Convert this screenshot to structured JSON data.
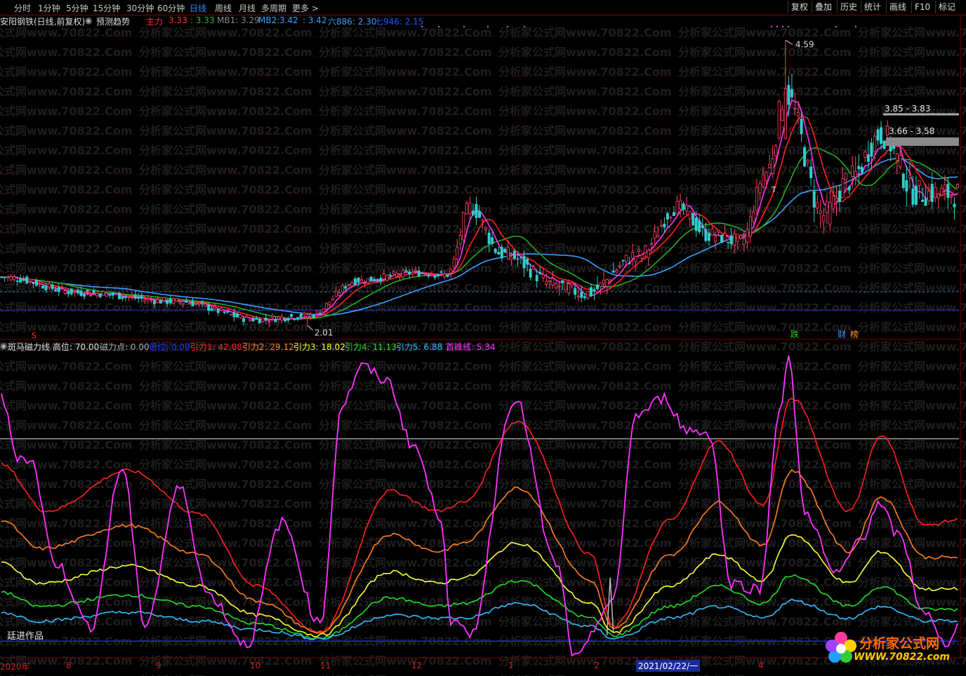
{
  "toolbar": {
    "timeframes": [
      "分时",
      "1分钟",
      "5分钟",
      "15分钟",
      "30分钟",
      "60分钟",
      "日线",
      "周线",
      "月线",
      "多周期",
      "更多 >"
    ],
    "active": "日线",
    "right_buttons": [
      "复权",
      "叠加",
      "历史",
      "统计",
      "画线",
      "F10",
      "标记"
    ]
  },
  "header": {
    "title": "安阳钢铁(日线,前复权)",
    "predict": "预测趋势",
    "zhuli_label": "主力",
    "zhuli_val": "3.33",
    "v2": ": 3.33",
    "mb1": "MB1: 3.29",
    "mb2_label": "MB2:",
    "mb2_val": "3.42",
    "v3": ": 3.42",
    "liu": "六886: 2.30",
    "qi": "七946: 2.15"
  },
  "osc_header": {
    "name": "斑马磁力线",
    "gao": "高位: 70.00",
    "cili": "磁力点: 0.00",
    "diwei": "低位: 0.00",
    "yl1": "引力1: 42.08",
    "yl2": "引力2: 29.12",
    "yl3": "引力3: 18.02",
    "yl4": "引力4: 11.13",
    "yl5": "引力5: 6.88",
    "sf": "首峰线: 5.34"
  },
  "annotations": {
    "high": "4.59",
    "low": "2.01",
    "range1": "3.85 - 3.83",
    "range2": "3.66 - 3.58",
    "tag_die": "跌",
    "tag_cai": "财",
    "tag_bang": "榜",
    "tag_s": "S",
    "tag_t": "T"
  },
  "watermark": "分析家公式网www.70822.Com",
  "credit": "廷进作品",
  "logo": {
    "text": "分析家公式网",
    "url": "WWW.70822.com"
  },
  "time_axis": {
    "labels": [
      "2020年",
      "8",
      "9",
      "10",
      "11",
      "12",
      "1",
      "2",
      "4"
    ],
    "current": "2021/02/22/一"
  },
  "colors": {
    "up": "#ff4466",
    "down": "#33cccc",
    "ma_red": "#ff2020",
    "ma_magenta": "#ff33ff",
    "ma_green": "#22aa22",
    "ma_blue": "#3aa0ff",
    "yl1": "#ff2020",
    "yl2": "#ff7f1e",
    "yl3": "#ffff33",
    "yl4": "#22dd22",
    "yl5": "#33bbff",
    "sf": "#ff33ff"
  },
  "chart_data": [
    {
      "type": "candlestick",
      "title": "安阳钢铁(日线,前复权)",
      "ylim": [
        1.9,
        4.7
      ],
      "annotated_high": 4.59,
      "annotated_low": 2.01,
      "close_series_keypoints": [
        {
          "i": 0,
          "v": 2.45
        },
        {
          "i": 25,
          "v": 2.31
        },
        {
          "i": 55,
          "v": 2.23
        },
        {
          "i": 80,
          "v": 2.07
        },
        {
          "i": 96,
          "v": 2.1
        },
        {
          "i": 112,
          "v": 2.42
        },
        {
          "i": 130,
          "v": 2.49
        },
        {
          "i": 140,
          "v": 2.47
        },
        {
          "i": 147,
          "v": 3.08
        },
        {
          "i": 157,
          "v": 2.66
        },
        {
          "i": 175,
          "v": 2.37
        },
        {
          "i": 183,
          "v": 2.3
        },
        {
          "i": 200,
          "v": 2.65
        },
        {
          "i": 212,
          "v": 3.08
        },
        {
          "i": 222,
          "v": 2.83
        },
        {
          "i": 232,
          "v": 2.77
        },
        {
          "i": 240,
          "v": 3.4
        },
        {
          "i": 246,
          "v": 4.1
        },
        {
          "i": 258,
          "v": 3.01
        },
        {
          "i": 266,
          "v": 3.33
        },
        {
          "i": 276,
          "v": 3.74
        },
        {
          "i": 287,
          "v": 3.21
        },
        {
          "i": 300,
          "v": 3.2
        }
      ]
    },
    {
      "type": "line",
      "title": "斑马磁力线",
      "ylim": [
        -5,
        100
      ],
      "reference_lines": {
        "gao": 70,
        "di": 0
      },
      "series": [
        {
          "name": "引力1",
          "keypoints": [
            {
              "i": 0,
              "v": 61
            },
            {
              "i": 14,
              "v": 45
            },
            {
              "i": 40,
              "v": 59
            },
            {
              "i": 62,
              "v": 44
            },
            {
              "i": 80,
              "v": 19
            },
            {
              "i": 100,
              "v": 3
            },
            {
              "i": 122,
              "v": 52
            },
            {
              "i": 137,
              "v": 45
            },
            {
              "i": 145,
              "v": 48
            },
            {
              "i": 162,
              "v": 76
            },
            {
              "i": 185,
              "v": 30
            },
            {
              "i": 192,
              "v": 5
            },
            {
              "i": 210,
              "v": 42
            },
            {
              "i": 225,
              "v": 69
            },
            {
              "i": 239,
              "v": 47
            },
            {
              "i": 248,
              "v": 84
            },
            {
              "i": 266,
              "v": 45
            },
            {
              "i": 276,
              "v": 71
            },
            {
              "i": 290,
              "v": 40
            },
            {
              "i": 300,
              "v": 42
            }
          ]
        },
        {
          "name": "引力2",
          "keypoints": [
            {
              "i": 0,
              "v": 42
            },
            {
              "i": 12,
              "v": 32
            },
            {
              "i": 40,
              "v": 40
            },
            {
              "i": 62,
              "v": 30
            },
            {
              "i": 80,
              "v": 14
            },
            {
              "i": 100,
              "v": 3
            },
            {
              "i": 122,
              "v": 37
            },
            {
              "i": 137,
              "v": 31
            },
            {
              "i": 145,
              "v": 34
            },
            {
              "i": 162,
              "v": 53
            },
            {
              "i": 185,
              "v": 21
            },
            {
              "i": 192,
              "v": 4
            },
            {
              "i": 210,
              "v": 30
            },
            {
              "i": 225,
              "v": 48
            },
            {
              "i": 239,
              "v": 33
            },
            {
              "i": 248,
              "v": 59
            },
            {
              "i": 266,
              "v": 31
            },
            {
              "i": 276,
              "v": 50
            },
            {
              "i": 290,
              "v": 29
            },
            {
              "i": 300,
              "v": 29
            }
          ]
        },
        {
          "name": "引力3",
          "keypoints": [
            {
              "i": 0,
              "v": 27
            },
            {
              "i": 12,
              "v": 20
            },
            {
              "i": 40,
              "v": 26
            },
            {
              "i": 62,
              "v": 19
            },
            {
              "i": 80,
              "v": 9
            },
            {
              "i": 100,
              "v": 2
            },
            {
              "i": 122,
              "v": 24
            },
            {
              "i": 137,
              "v": 20
            },
            {
              "i": 145,
              "v": 22
            },
            {
              "i": 162,
              "v": 34
            },
            {
              "i": 185,
              "v": 13
            },
            {
              "i": 192,
              "v": 3
            },
            {
              "i": 210,
              "v": 19
            },
            {
              "i": 225,
              "v": 30
            },
            {
              "i": 239,
              "v": 21
            },
            {
              "i": 248,
              "v": 37
            },
            {
              "i": 266,
              "v": 20
            },
            {
              "i": 276,
              "v": 31
            },
            {
              "i": 290,
              "v": 18
            },
            {
              "i": 300,
              "v": 18
            }
          ]
        },
        {
          "name": "引力4",
          "keypoints": [
            {
              "i": 0,
              "v": 17
            },
            {
              "i": 12,
              "v": 12
            },
            {
              "i": 40,
              "v": 16
            },
            {
              "i": 62,
              "v": 12
            },
            {
              "i": 80,
              "v": 6
            },
            {
              "i": 100,
              "v": 1
            },
            {
              "i": 122,
              "v": 15
            },
            {
              "i": 137,
              "v": 12
            },
            {
              "i": 145,
              "v": 13
            },
            {
              "i": 162,
              "v": 21
            },
            {
              "i": 185,
              "v": 8
            },
            {
              "i": 192,
              "v": 2
            },
            {
              "i": 210,
              "v": 12
            },
            {
              "i": 225,
              "v": 19
            },
            {
              "i": 239,
              "v": 13
            },
            {
              "i": 248,
              "v": 23
            },
            {
              "i": 266,
              "v": 12
            },
            {
              "i": 276,
              "v": 19
            },
            {
              "i": 290,
              "v": 11
            },
            {
              "i": 300,
              "v": 11
            }
          ]
        },
        {
          "name": "引力5",
          "keypoints": [
            {
              "i": 0,
              "v": 10
            },
            {
              "i": 12,
              "v": 7
            },
            {
              "i": 40,
              "v": 10
            },
            {
              "i": 62,
              "v": 7
            },
            {
              "i": 80,
              "v": 4
            },
            {
              "i": 100,
              "v": 1
            },
            {
              "i": 122,
              "v": 9
            },
            {
              "i": 137,
              "v": 8
            },
            {
              "i": 145,
              "v": 8
            },
            {
              "i": 162,
              "v": 13
            },
            {
              "i": 185,
              "v": 5
            },
            {
              "i": 192,
              "v": 1
            },
            {
              "i": 210,
              "v": 8
            },
            {
              "i": 225,
              "v": 12
            },
            {
              "i": 239,
              "v": 8
            },
            {
              "i": 248,
              "v": 14
            },
            {
              "i": 266,
              "v": 8
            },
            {
              "i": 276,
              "v": 12
            },
            {
              "i": 290,
              "v": 7
            },
            {
              "i": 300,
              "v": 7
            }
          ]
        },
        {
          "name": "首峰线",
          "keypoints": [
            {
              "i": 0,
              "v": 84
            },
            {
              "i": 5,
              "v": 64
            },
            {
              "i": 9,
              "v": 63
            },
            {
              "i": 17,
              "v": 27
            },
            {
              "i": 28,
              "v": 5
            },
            {
              "i": 38,
              "v": 60
            },
            {
              "i": 45,
              "v": 6
            },
            {
              "i": 56,
              "v": 53
            },
            {
              "i": 65,
              "v": 16
            },
            {
              "i": 77,
              "v": -1
            },
            {
              "i": 88,
              "v": 41
            },
            {
              "i": 100,
              "v": 6
            },
            {
              "i": 107,
              "v": 82
            },
            {
              "i": 113,
              "v": 95
            },
            {
              "i": 121,
              "v": 90
            },
            {
              "i": 129,
              "v": 68
            },
            {
              "i": 138,
              "v": 43
            },
            {
              "i": 141,
              "v": 7
            },
            {
              "i": 147,
              "v": 2
            },
            {
              "i": 161,
              "v": 84
            },
            {
              "i": 174,
              "v": 27
            },
            {
              "i": 180,
              "v": -6
            },
            {
              "i": 192,
              "v": 14
            },
            {
              "i": 199,
              "v": 78
            },
            {
              "i": 208,
              "v": 84
            },
            {
              "i": 215,
              "v": 73
            },
            {
              "i": 222,
              "v": 72
            },
            {
              "i": 229,
              "v": 20
            },
            {
              "i": 238,
              "v": 18
            },
            {
              "i": 244,
              "v": 79
            },
            {
              "i": 247,
              "v": 97
            },
            {
              "i": 252,
              "v": 45
            },
            {
              "i": 262,
              "v": 23
            },
            {
              "i": 270,
              "v": 36
            },
            {
              "i": 275,
              "v": 47
            },
            {
              "i": 282,
              "v": 36
            },
            {
              "i": 289,
              "v": 11
            },
            {
              "i": 296,
              "v": -1
            },
            {
              "i": 300,
              "v": 5
            }
          ]
        }
      ]
    }
  ]
}
